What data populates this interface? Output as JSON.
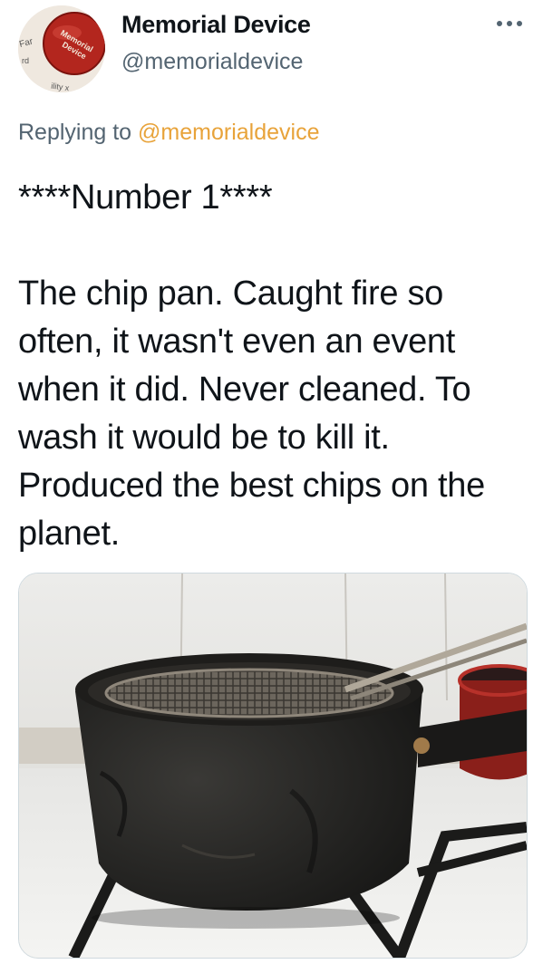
{
  "tweet": {
    "author": {
      "display_name": "Memorial Device",
      "handle": "@memorialdevice"
    },
    "avatar_text": [
      "Memorial",
      "Device",
      "Far",
      "rd",
      "ility x"
    ],
    "replying_prefix": "Replying to",
    "replying_to": "@memorialdevice",
    "text": "****Number 1****\n\nThe chip pan. Caught fire so often, it wasn't even an event when it did. Never cleaned. To wash it would be to kill it. Produced the best chips on the planet.",
    "media_alt": "Blackened chip pan with wire frying basket on a gas hob",
    "icons": {
      "more": "more-horizontal-icon"
    },
    "colors": {
      "mention": "#e8a33a",
      "muted": "#536471",
      "text": "#0f1419"
    }
  }
}
